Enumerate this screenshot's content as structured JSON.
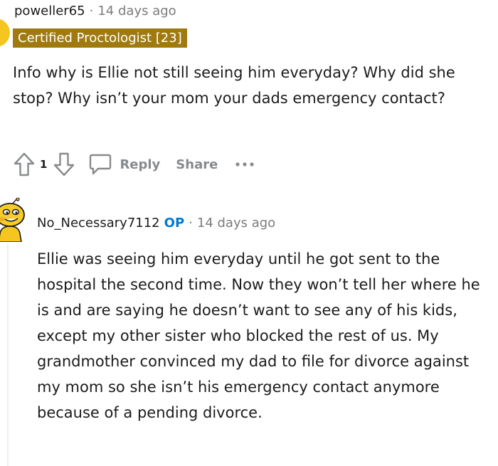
{
  "comment1": {
    "username": "poweller65",
    "separator": "·",
    "timestamp": "14 days ago",
    "flair": "Certified Proctologist [23]",
    "body": "Info why is Ellie not still seeing him everyday? Why did she stop? Why isn’t your mom your dads emergency contact?",
    "vote_count": "1",
    "reply_label": "Reply",
    "share_label": "Share",
    "more_label": "···"
  },
  "comment2": {
    "username": "No_Necessary7112",
    "op_badge": "OP",
    "separator": "·",
    "timestamp": "14 days ago",
    "body": "Ellie was seeing him everyday until he got sent to the hospital the second time. Now they won’t tell her where he is and are saying he doesn’t want to see any of his kids, except my other sister who blocked the rest of us. My grandmother convinced my dad to file for divorce against my mom so she isn’t his emergency contact anymore because of a pending divorce."
  },
  "colors": {
    "flair_bg": "#a07a0f",
    "op": "#0079d3",
    "meta": "#7c7c7c",
    "action": "#878a8c",
    "avatar1": "#f5c520"
  },
  "icons": {
    "upvote": "upvote-arrow-icon",
    "downvote": "downvote-arrow-icon",
    "reply": "speech-bubble-icon",
    "more": "more-dots-icon",
    "avatar2": "snoo-avatar-icon"
  }
}
